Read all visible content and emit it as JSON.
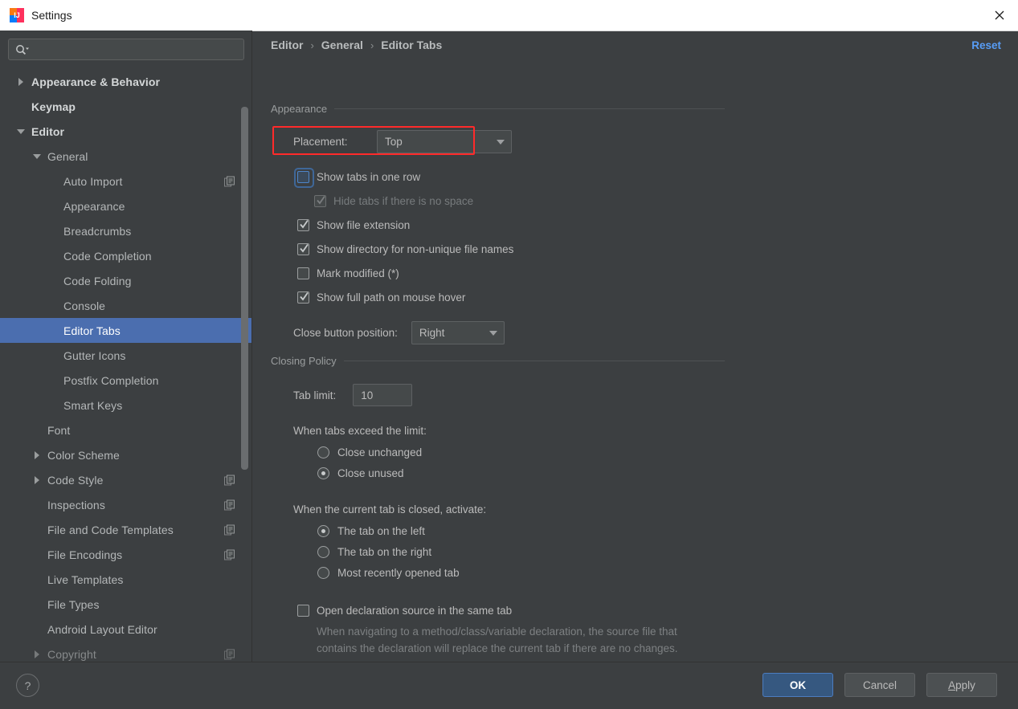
{
  "window": {
    "title": "Settings",
    "app_icon": "intellij-idea-icon",
    "close_icon": "close-icon"
  },
  "sidebar": {
    "search": {
      "placeholder": "",
      "value": "",
      "icon": "search-icon"
    },
    "items": [
      {
        "label": "Appearance & Behavior",
        "indent": 0,
        "arrow": "collapsed",
        "top": true,
        "selected": false,
        "copy": false
      },
      {
        "label": "Keymap",
        "indent": 0,
        "arrow": "none",
        "top": true,
        "selected": false,
        "copy": false
      },
      {
        "label": "Editor",
        "indent": 0,
        "arrow": "expanded",
        "top": true,
        "selected": false,
        "copy": false
      },
      {
        "label": "General",
        "indent": 1,
        "arrow": "expanded",
        "top": false,
        "selected": false,
        "copy": false
      },
      {
        "label": "Auto Import",
        "indent": 2,
        "arrow": "none",
        "top": false,
        "selected": false,
        "copy": true
      },
      {
        "label": "Appearance",
        "indent": 2,
        "arrow": "none",
        "top": false,
        "selected": false,
        "copy": false
      },
      {
        "label": "Breadcrumbs",
        "indent": 2,
        "arrow": "none",
        "top": false,
        "selected": false,
        "copy": false
      },
      {
        "label": "Code Completion",
        "indent": 2,
        "arrow": "none",
        "top": false,
        "selected": false,
        "copy": false
      },
      {
        "label": "Code Folding",
        "indent": 2,
        "arrow": "none",
        "top": false,
        "selected": false,
        "copy": false
      },
      {
        "label": "Console",
        "indent": 2,
        "arrow": "none",
        "top": false,
        "selected": false,
        "copy": false
      },
      {
        "label": "Editor Tabs",
        "indent": 2,
        "arrow": "none",
        "top": false,
        "selected": true,
        "copy": false
      },
      {
        "label": "Gutter Icons",
        "indent": 2,
        "arrow": "none",
        "top": false,
        "selected": false,
        "copy": false
      },
      {
        "label": "Postfix Completion",
        "indent": 2,
        "arrow": "none",
        "top": false,
        "selected": false,
        "copy": false
      },
      {
        "label": "Smart Keys",
        "indent": 2,
        "arrow": "none",
        "top": false,
        "selected": false,
        "copy": false
      },
      {
        "label": "Font",
        "indent": 1,
        "arrow": "none",
        "top": false,
        "selected": false,
        "copy": false
      },
      {
        "label": "Color Scheme",
        "indent": 1,
        "arrow": "collapsed",
        "top": false,
        "selected": false,
        "copy": false
      },
      {
        "label": "Code Style",
        "indent": 1,
        "arrow": "collapsed",
        "top": false,
        "selected": false,
        "copy": true
      },
      {
        "label": "Inspections",
        "indent": 1,
        "arrow": "none",
        "top": false,
        "selected": false,
        "copy": true
      },
      {
        "label": "File and Code Templates",
        "indent": 1,
        "arrow": "none",
        "top": false,
        "selected": false,
        "copy": true
      },
      {
        "label": "File Encodings",
        "indent": 1,
        "arrow": "none",
        "top": false,
        "selected": false,
        "copy": true
      },
      {
        "label": "Live Templates",
        "indent": 1,
        "arrow": "none",
        "top": false,
        "selected": false,
        "copy": false
      },
      {
        "label": "File Types",
        "indent": 1,
        "arrow": "none",
        "top": false,
        "selected": false,
        "copy": false
      },
      {
        "label": "Android Layout Editor",
        "indent": 1,
        "arrow": "none",
        "top": false,
        "selected": false,
        "copy": false
      },
      {
        "label": "Copyright",
        "indent": 1,
        "arrow": "collapsed",
        "top": false,
        "selected": false,
        "copy": true
      }
    ]
  },
  "header": {
    "breadcrumb": [
      "Editor",
      "General",
      "Editor Tabs"
    ],
    "separator": "›",
    "reset_label": "Reset"
  },
  "appearance_group": {
    "title": "Appearance",
    "placement_label": "Placement:",
    "placement_value": "Top",
    "checkboxes": [
      {
        "label": "Show tabs in one row",
        "checked": false,
        "disabled": false,
        "focused": true,
        "indent": 0,
        "annotated": true
      },
      {
        "label": "Hide tabs if there is no space",
        "checked": true,
        "disabled": true,
        "focused": false,
        "indent": 1,
        "annotated": false
      },
      {
        "label": "Show file extension",
        "checked": true,
        "disabled": false,
        "focused": false,
        "indent": 0,
        "annotated": false
      },
      {
        "label": "Show directory for non-unique file names",
        "checked": true,
        "disabled": false,
        "focused": false,
        "indent": 0,
        "annotated": false
      },
      {
        "label": "Mark modified (*)",
        "checked": false,
        "disabled": false,
        "focused": false,
        "indent": 0,
        "annotated": false
      },
      {
        "label": "Show full path on mouse hover",
        "checked": true,
        "disabled": false,
        "focused": false,
        "indent": 0,
        "annotated": false
      }
    ],
    "close_button_label": "Close button position:",
    "close_button_value": "Right"
  },
  "closing_policy_group": {
    "title": "Closing Policy",
    "tab_limit_label": "Tab limit:",
    "tab_limit_value": "10",
    "exceed_label": "When tabs exceed the limit:",
    "exceed_options": [
      {
        "label": "Close unchanged",
        "selected": false
      },
      {
        "label": "Close unused",
        "selected": true
      }
    ],
    "activate_label": "When the current tab is closed, activate:",
    "activate_options": [
      {
        "label": "The tab on the left",
        "selected": true
      },
      {
        "label": "The tab on the right",
        "selected": false
      },
      {
        "label": "Most recently opened tab",
        "selected": false
      }
    ],
    "open_declaration": {
      "label": "Open declaration source in the same tab",
      "checked": false,
      "description": "When navigating to a method/class/variable declaration, the source file that contains the declaration will replace the current tab if there are no changes."
    }
  },
  "footer": {
    "help_icon": "question-mark-icon",
    "ok_label": "OK",
    "cancel_label": "Cancel",
    "apply_label": "Apply",
    "apply_mnemonic": "A",
    "apply_rest": "pply"
  },
  "colors": {
    "accent_blue": "#4b6eaf",
    "link_blue": "#589df6",
    "annotation_red": "#ff2a2a",
    "panel_bg": "#3c3f41",
    "field_bg": "#45494a"
  }
}
